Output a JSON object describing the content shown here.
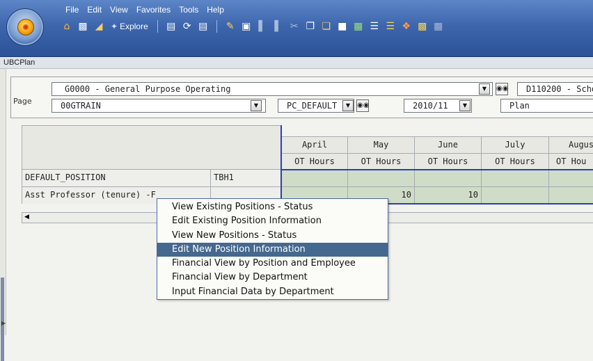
{
  "menubar": {
    "items": [
      {
        "label": "File"
      },
      {
        "label": "Edit"
      },
      {
        "label": "View"
      },
      {
        "label": "Favorites"
      },
      {
        "label": "Tools"
      },
      {
        "label": "Help"
      }
    ]
  },
  "toolbar": {
    "explore_label": "Explore",
    "icons": [
      "home-icon",
      "new-doc-icon",
      "open-folder-icon",
      "explore-icon",
      "save-icon",
      "refresh-icon",
      "print-icon",
      "edit-icon",
      "lock-icon",
      "chart-icon",
      "chart2-icon",
      "cut-icon",
      "copy-icon",
      "paste-icon",
      "spellcheck-icon",
      "map-icon",
      "tree-icon",
      "list-icon",
      "pin-icon",
      "report-icon",
      "grid-icon"
    ]
  },
  "title": "UBCPlan",
  "page": {
    "label": "Page",
    "fund": "G0000 - General Purpose Operating",
    "dept": "D110200 - Scho",
    "org": "00GTRAIN",
    "pc": "PC_DEFAULT",
    "year": "2010/11",
    "scenario": "Plan"
  },
  "grid": {
    "months": [
      "April",
      "May",
      "June",
      "July",
      "Augus"
    ],
    "measure": [
      "OT Hours",
      "OT Hours",
      "OT Hours",
      "OT Hours",
      "OT Hou"
    ],
    "rows": [
      {
        "label": "DEFAULT_POSITION",
        "code": "TBH1",
        "values": [
          "",
          "",
          "",
          "",
          ""
        ]
      },
      {
        "label": "Asst Professor (tenure) -F",
        "code": "",
        "values": [
          "",
          "10",
          "10",
          "",
          ""
        ]
      }
    ]
  },
  "context_menu": {
    "items": [
      {
        "label": "View Existing Positions - Status"
      },
      {
        "label": "Edit Existing Position Information"
      },
      {
        "label": "View New Positions - Status"
      },
      {
        "label": "Edit New Position Information"
      },
      {
        "label": "Financial View by Position and Employee"
      },
      {
        "label": "Financial View by Department"
      },
      {
        "label": "Input Financial Data by Department"
      }
    ],
    "selected_index": 3
  },
  "colors": {
    "toolbar_blue": "#3d66ad",
    "data_cell": "#cfdcc7",
    "selection": "#45688e",
    "highlight_border": "#2a3fb5"
  }
}
